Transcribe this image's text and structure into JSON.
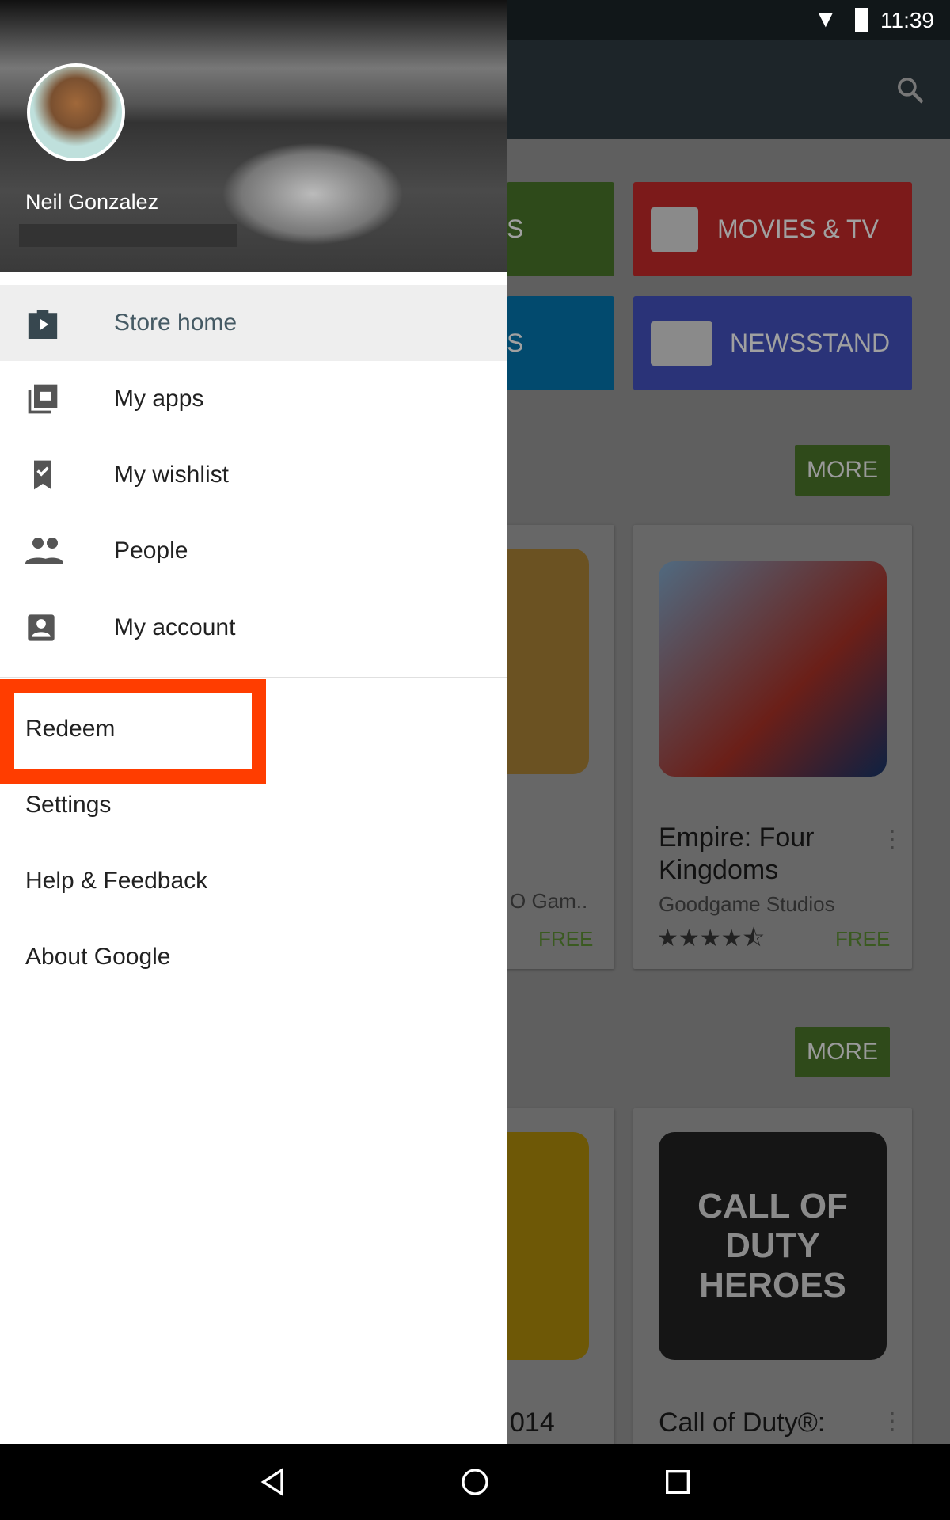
{
  "status": {
    "time": "11:39"
  },
  "background": {
    "tiles": [
      {
        "label": "MOVIES & TV",
        "color": "#e53935"
      },
      {
        "label": "NEWSSTAND",
        "color": "#3f51b5"
      }
    ],
    "left_tiles": [
      {
        "label": "S",
        "color": "#689f38"
      },
      {
        "label": "S",
        "color": "#0288d1"
      }
    ],
    "more_label": "MORE",
    "cards": [
      {
        "title": "Empire: Four Kingdoms",
        "developer": "Goodgame Studios",
        "rating": 4.5,
        "price": "FREE"
      },
      {
        "title": "Call of Duty®:",
        "logo_text": "CALL OF DUTY HEROES"
      }
    ],
    "left_cards": [
      {
        "developer": "O Gam..",
        "price": "FREE"
      },
      {
        "title": "014"
      }
    ]
  },
  "drawer": {
    "user_name": "Neil Gonzalez",
    "primary": [
      {
        "label": "Store home",
        "icon": "store-bag-icon",
        "active": true
      },
      {
        "label": "My apps",
        "icon": "my-apps-icon"
      },
      {
        "label": "My wishlist",
        "icon": "wishlist-bookmark-icon"
      },
      {
        "label": "People",
        "icon": "people-icon"
      },
      {
        "label": "My account",
        "icon": "account-icon"
      }
    ],
    "secondary": [
      {
        "label": "Redeem",
        "highlighted": true
      },
      {
        "label": "Settings"
      },
      {
        "label": "Help & Feedback"
      },
      {
        "label": "About Google"
      }
    ],
    "highlight_color": "#ff3d00"
  }
}
